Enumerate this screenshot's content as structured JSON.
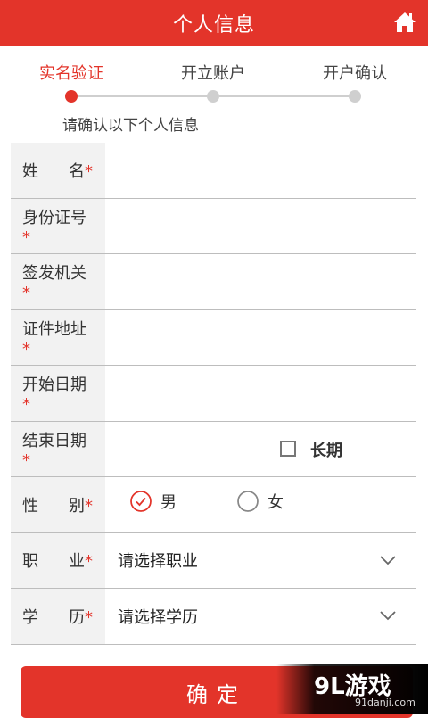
{
  "header": {
    "title": "个人信息",
    "home_icon": "home-icon"
  },
  "steps": {
    "items": [
      {
        "label": "实名验证",
        "active": true
      },
      {
        "label": "开立账户",
        "active": false
      },
      {
        "label": "开户确认",
        "active": false
      }
    ]
  },
  "hint": "请确认以下个人信息",
  "form": {
    "name": {
      "label_a": "姓",
      "label_b": "名",
      "req": "*",
      "value": ""
    },
    "id_number": {
      "label": "身份证号",
      "req": "*",
      "value": ""
    },
    "issuer": {
      "label": "签发机关",
      "req": "*",
      "value": ""
    },
    "address": {
      "label": "证件地址",
      "req": "*",
      "value": ""
    },
    "start_date": {
      "label": "开始日期",
      "req": "*",
      "value": ""
    },
    "end_date": {
      "label": "结束日期",
      "req": "*",
      "value": "",
      "long_term_label": "长期",
      "long_term_checked": false
    },
    "gender": {
      "label_a": "性",
      "label_b": "别",
      "req": "*",
      "male": "男",
      "female": "女",
      "selected": "男"
    },
    "occupation": {
      "label_a": "职",
      "label_b": "业",
      "req": "*",
      "placeholder": "请选择职业"
    },
    "education": {
      "label_a": "学",
      "label_b": "历",
      "req": "*",
      "placeholder": "请选择学历"
    }
  },
  "confirm_label": "确定",
  "watermark": {
    "main": "9L游戏",
    "sub": "91danji.com"
  },
  "colors": {
    "accent": "#e3342a",
    "divider": "#bdbdbd",
    "label_bg": "#f2f2f2"
  }
}
